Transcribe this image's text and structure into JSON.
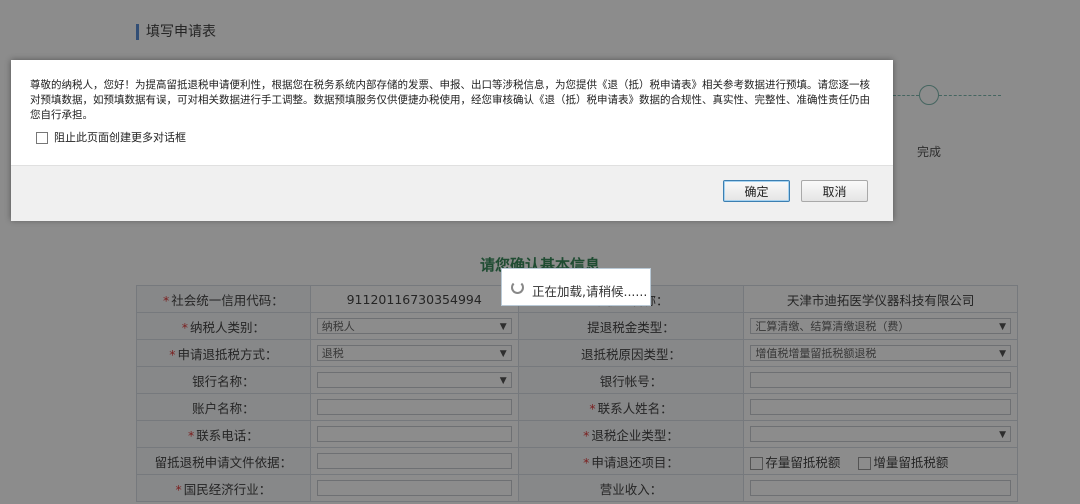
{
  "page": {
    "section_title": "填写申请表",
    "step_label": "完成",
    "form_heading": "请您确认基本信息",
    "form": {
      "credit_code_label": "社会统一信用代码：",
      "credit_code_value": "91120116730354994",
      "taxpayer_name_label": "纳税人名称：",
      "taxpayer_name_value": "天津市迪拓医学仪器科技有限公司",
      "taxpayer_type_label": "纳税人类别：",
      "taxpayer_type_value": "纳税人",
      "refund_type_label": "提退税金类型：",
      "refund_type_value": "汇算清缴、结算清缴退税（费）",
      "refund_method_label": "申请退抵税方式：",
      "refund_method_value": "退税",
      "refund_reason_label": "退抵税原因类型：",
      "refund_reason_value": "增值税增量留抵税额退税",
      "bank_name_label": "银行名称：",
      "bank_account_label": "银行帐号：",
      "account_name_label": "账户名称：",
      "contact_name_label": "联系人姓名：",
      "phone_label": "联系电话：",
      "enterprise_type_label": "退税企业类型：",
      "basis_label": "留抵退税申请文件依据：",
      "refund_item_label": "申请退还项目：",
      "option_stock": "存量留抵税额",
      "option_increment": "增量留抵税额",
      "industry_label": "国民经济行业：",
      "revenue_label": "营业收入："
    }
  },
  "dialog": {
    "message": "尊敬的纳税人，您好！为提高留抵退税申请便利性，根据您在税务系统内部存储的发票、申报、出口等涉税信息，为您提供《退（抵）税申请表》相关参考数据进行预填。请您逐一核对预填数据，如预填数据有误，可对相关数据进行手工调整。数据预填服务仅供便捷办税使用，经您审核确认《退（抵）税申请表》数据的合规性、真实性、完整性、准确性责任仍由您自行承担。",
    "checkbox_label": "阻止此页面创建更多对话框",
    "ok_label": "确定",
    "cancel_label": "取消"
  },
  "loading": {
    "text": "正在加载,请稍候......"
  }
}
